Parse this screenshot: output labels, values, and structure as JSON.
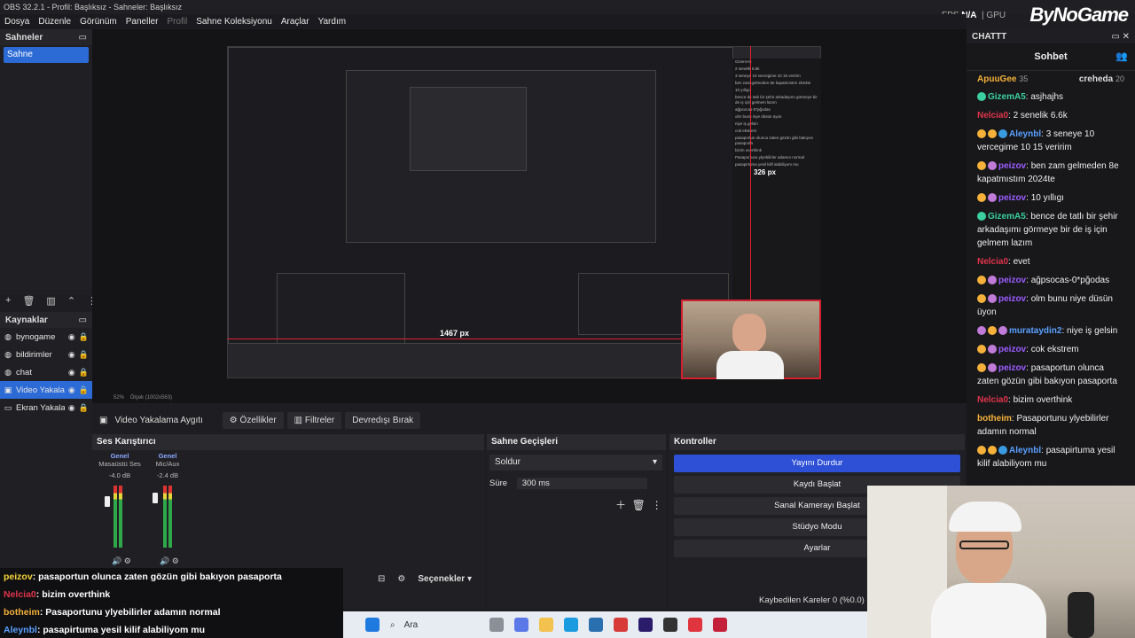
{
  "window": {
    "title": "OBS 32.2.1 - Profil: Başlıksız - Sahneler: Başlıksız",
    "brand": "ByNoGame",
    "fps_label": "FPS",
    "fps_value": "N/A",
    "gpu_label": "GPU"
  },
  "menu": {
    "items": [
      "Dosya",
      "Düzenle",
      "Görünüm",
      "Paneller",
      "Profil",
      "Sahne Koleksiyonu",
      "Araçlar",
      "Yardım"
    ]
  },
  "scenes": {
    "title": "Sahneler",
    "items": [
      "Sahne"
    ]
  },
  "sources": {
    "title": "Kaynaklar",
    "items": [
      {
        "name": "bynogame",
        "icon": "globe-icon"
      },
      {
        "name": "bildirimler",
        "icon": "globe-icon"
      },
      {
        "name": "chat",
        "icon": "globe-icon"
      },
      {
        "name": "Video Yakalama Aygıtı",
        "icon": "camera-icon",
        "selected": true
      },
      {
        "name": "Ekran Yakalama",
        "icon": "monitor-icon"
      }
    ]
  },
  "preview": {
    "px_label": "1467 px",
    "px_label_small": "326 px",
    "zoom": "52%",
    "dims": "Ölçek (1002x563)"
  },
  "source_toolbar": {
    "source": "Video Yakalama Aygıtı",
    "properties": "Özellikler",
    "filters": "Filtreler",
    "deactivate": "Devredışı Bırak"
  },
  "mixer": {
    "title": "Ses Karıştırıcı",
    "channels": [
      {
        "group": "Genel",
        "name": "Masaüstü Ses",
        "db": "-4.0 dB"
      },
      {
        "group": "Genel",
        "name": "Mic/Aux",
        "db": "-2.4 dB"
      }
    ],
    "scale": [
      "0",
      "-6",
      "-12",
      "-18",
      "-24",
      "-30",
      "-36",
      "-42",
      "-48",
      "-54",
      "-60"
    ]
  },
  "transitions": {
    "title": "Sahne Geçişleri",
    "selected": "Soldur",
    "duration_label": "Süre",
    "duration_value": "300 ms"
  },
  "controls": {
    "title": "Kontroller",
    "buttons": [
      "Yayını Durdur",
      "Kaydı Başlat",
      "Sanal Kamerayı Başlat",
      "Stüdyo Modu",
      "Ayarlar"
    ]
  },
  "footer": {
    "options": "Seçenekler",
    "lost_frames": "Kaybedilen Kareler 0 (%0.0)"
  },
  "chat": {
    "title": "CHATTT",
    "header": "Sohbet",
    "gifters": [
      {
        "name": "ApuuGee",
        "count": "35"
      },
      {
        "name": "creheda",
        "count": "20"
      }
    ],
    "messages": [
      {
        "user": "GizemA5",
        "color": "#3ad0a0",
        "text": "asjhajhs"
      },
      {
        "user": "Nelcia0",
        "color": "#e0344a",
        "text": "2 senelik 6.6k"
      },
      {
        "user": "Aleynbl",
        "color": "#5aa0ff",
        "text": "3 seneye 10 vercegime 10 15 veririm"
      },
      {
        "user": "peizov",
        "color": "#9b5cff",
        "text": "ben zam gelmeden 8e kapatmıstım 2024te"
      },
      {
        "user": "peizov",
        "color": "#9b5cff",
        "text": "10 yıllıgı"
      },
      {
        "user": "GizemA5",
        "color": "#3ad0a0",
        "text": "bence de tatlı bir şehir arkadaşımı görmeye bir de iş için gelmem lazım"
      },
      {
        "user": "Nelcia0",
        "color": "#e0344a",
        "text": "evet"
      },
      {
        "user": "peizov",
        "color": "#9b5cff",
        "text": "ağpsocas-0*pğodas"
      },
      {
        "user": "peizov",
        "color": "#9b5cff",
        "text": "olm bunu niye düsün üyon"
      },
      {
        "user": "murataydin2",
        "color": "#5aa0ff",
        "text": "niye iş gelsin"
      },
      {
        "user": "peizov",
        "color": "#9b5cff",
        "text": "cok ekstrem"
      },
      {
        "user": "peizov",
        "color": "#9b5cff",
        "text": "pasaportun olunca zaten gözün gibi bakıyon pasaporta"
      },
      {
        "user": "Nelcia0",
        "color": "#e0344a",
        "text": "bizim overthink"
      },
      {
        "user": "botheim",
        "color": "#f5b13a",
        "text": "Pasaportunu ylyebilirler adamın normal"
      },
      {
        "user": "Aleynbl",
        "color": "#5aa0ff",
        "text": "pasapirtuma yesil kilif alabiliyom mu"
      }
    ]
  },
  "overlay": {
    "messages": [
      {
        "user": "peizov",
        "color": "#f5d33a",
        "text": ": pasaportun olunca zaten gözün gibi bakıyon pasaporta"
      },
      {
        "user": "Nelcia0",
        "color": "#e0344a",
        "text": ": bizim overthink"
      },
      {
        "user": "botheim",
        "color": "#f5b13a",
        "text": ": Pasaportunu ylyebilirler adamın normal"
      },
      {
        "user": "Aleynbl",
        "color": "#5aa0ff",
        "text": ": pasapirtuma yesil kilif alabiliyom mu"
      }
    ]
  },
  "taskbar": {
    "search": "Ara"
  }
}
